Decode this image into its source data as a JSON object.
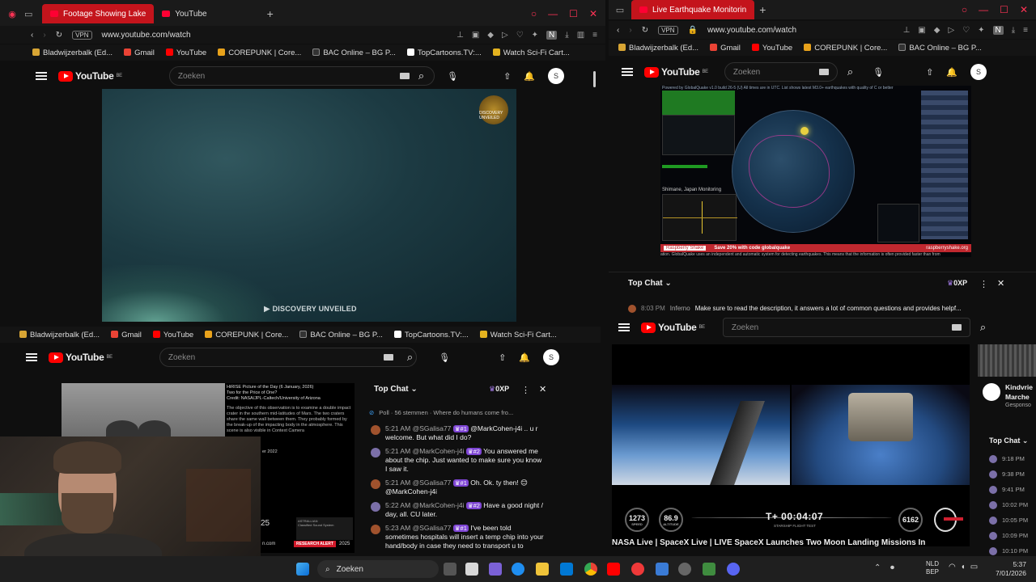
{
  "window_tl": {
    "tabs": [
      {
        "label": "Footage Showing Lake",
        "active": true
      },
      {
        "label": "YouTube",
        "active": false
      }
    ],
    "url": "www.youtube.com/watch",
    "vpn": "VPN",
    "bookmarks": [
      "Bladwijzerbalk (Ed...",
      "Gmail",
      "YouTube",
      "COREPUNK | Core...",
      "BAC Online – BG P...",
      "TopCartoons.TV:...",
      "Watch Sci-Fi Cart..."
    ],
    "search_placeholder": "Zoeken",
    "avatar": "S",
    "video": {
      "watermark": "DISCOVERY UNVEILED",
      "logo_text": "DISCOVERY UNVEILED"
    }
  },
  "window_tr": {
    "tabs": [
      {
        "label": "Live Earthquake Monitorin",
        "active": true
      }
    ],
    "url": "www.youtube.com/watch",
    "vpn": "VPN",
    "bookmarks": [
      "Bladwijzerbalk (Ed...",
      "Gmail",
      "YouTube",
      "COREPUNK | Core...",
      "BAC Online – BG P..."
    ],
    "search_placeholder": "Zoeken",
    "avatar": "S",
    "video": {
      "header": "Powered by GlobalQuake v1.0 build 26-5 (U)     All times are in UTC. List shows latest M3.0+ earthquakes with quality of C or better",
      "monitoring": "Shimane, Japan Monitoring",
      "promo_brand": "Raspberry Shake",
      "promo": "Save 20% with code globalquake",
      "promo_url": "raspberryshake.org",
      "footer": "ation. GlobalQuake uses an independent and automatic system for detecting earthquakes. This means that the information is often provided faster than from"
    },
    "chat": {
      "title": "Top Chat",
      "xp": "0XP",
      "message_time": "8:03 PM",
      "message_author": "Inferno",
      "message_text": "Make sure to read the description, it answers a lot of common questions and provides helpf..."
    }
  },
  "window_bl": {
    "bookmarks": [
      "Bladwijzerbalk (Ed...",
      "Gmail",
      "YouTube",
      "COREPUNK | Core...",
      "BAC Online – BG P...",
      "TopCartoons.TV:...",
      "Watch Sci-Fi Cart..."
    ],
    "search_placeholder": "Zoeken",
    "avatar": "S",
    "video": {
      "title": "HiRISE Picture of the Day (6 January, 2026)\nTwo for the Price of One?\nCredit: NASA/JPL-Caltech/University of Arizona",
      "body": "The objective of this observation is to examine a double impact crater in the southern mid-latitudes of Mars. The two craters share the same wall between them. They probably formed by the break-up of the impacting body in the atmosphere. This scene is also visible in Context Camera",
      "date_fragment": "er 2022",
      "num": "25",
      "alert": "RESEARCH ALERT",
      "year": "2025",
      "label_a": "ASTRALLIAN",
      "label_b": "Classified Sound System",
      "url_fragment": "n.com"
    },
    "chat": {
      "title": "Top Chat",
      "xp": "0XP",
      "poll": "Poll · 56 stemmen · Where do humans come fro...",
      "messages": [
        {
          "time": "5:21 AM",
          "author": "@SGalisa77",
          "badge": "#1",
          "text": "@MarkCohen-j4i .. u r welcome. But what did I do?",
          "color": "#a0522d"
        },
        {
          "time": "5:21 AM",
          "author": "@MarkCohen-j4i",
          "badge": "#2",
          "text": "You answered me about the chip. Just wanted to make sure you know I saw it.",
          "color": "#7b6fa8"
        },
        {
          "time": "5:21 AM",
          "author": "@SGalisa77",
          "badge": "#1",
          "text": "Oh. Ok. ty then! 😊 @MarkCohen-j4i",
          "color": "#a0522d"
        },
        {
          "time": "5:22 AM",
          "author": "@MarkCohen-j4i",
          "badge": "#2",
          "text": "Have a good night / day, all. CU later.",
          "color": "#7b6fa8"
        },
        {
          "time": "5:23 AM",
          "author": "@SGalisa77",
          "badge": "#1",
          "text": "I've been told sometimes hospitals will insert a temp chip into your hand/body in case they need to transport u to",
          "color": "#a0522d"
        }
      ]
    }
  },
  "window_br": {
    "search_placeholder": "Zoeken",
    "video": {
      "speed": "1273",
      "speed_label": "SPEED",
      "altitude": "86.9",
      "altitude_label": "ALTITUDE",
      "timer": "T+ 00:04:07",
      "stage": "STARSHIP FLIGHT TEST",
      "right_value": "6162",
      "title": "NASA Live | SpaceX Live | LIVE SpaceX Launches Two Moon Landing Missions In"
    },
    "side": {
      "channel_top": "Kindvrie",
      "channel_mid": "Marche",
      "sponsored": "Gesponso",
      "chat_title": "Top Chat",
      "times": [
        "9:18 PM",
        "9:38 PM",
        "9:41 PM",
        "10:02 PM",
        "10:05 PM",
        "10:09 PM",
        "10:10 PM"
      ]
    }
  },
  "taskbar": {
    "search": "Zoeken",
    "lang": "NLD",
    "region": "BEP",
    "time": "5:37",
    "date": "7/01/2026"
  },
  "colors": {
    "youtube_red": "#ff0000",
    "tab_red": "#c4141c",
    "badge_purple": "#7e45d4"
  }
}
